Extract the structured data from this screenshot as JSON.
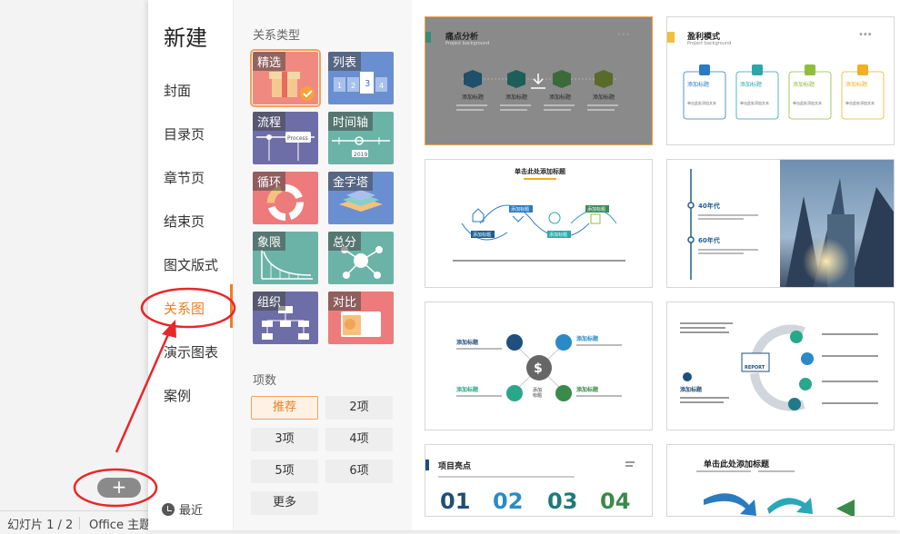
{
  "nav": {
    "title": "新建",
    "items": [
      "封面",
      "目录页",
      "章节页",
      "结束页",
      "图文版式",
      "关系图",
      "演示图表",
      "案例"
    ],
    "active": "关系图",
    "recent": "最近"
  },
  "categories": {
    "heading": "关系类型",
    "items": [
      "精选",
      "列表",
      "流程",
      "时间轴",
      "循环",
      "金字塔",
      "象限",
      "总分",
      "组织",
      "对比"
    ],
    "process_word": "Process",
    "year": "2019"
  },
  "counts": {
    "heading": "项数",
    "items": [
      "推荐",
      "2项",
      "3项",
      "4项",
      "5项",
      "6项",
      "更多"
    ]
  },
  "templates": {
    "t1": {
      "title": "痛点分析",
      "sub": "Project background",
      "label": "添加标题"
    },
    "t2": {
      "title": "盈利模式",
      "sub": "Project background",
      "label": "添加标题",
      "desc": "单击此处添加文本"
    },
    "t3": {
      "title": "单击此处添加标题",
      "label": "添加标题"
    },
    "t4": {
      "a": "40年代",
      "b": "60年代"
    },
    "t5": {
      "label": "添加标题",
      "center": "添加\n标题"
    },
    "t6": {
      "label": "添加标题",
      "report": "REPORT"
    },
    "t7": {
      "title": "项目亮点",
      "nums": [
        "01",
        "02",
        "03",
        "04"
      ]
    },
    "t8": {
      "title": "单击此处添加标题"
    }
  },
  "statusbar": {
    "slide": "幻灯片 1 / 2",
    "theme": "Office 主题"
  },
  "add_button": "+",
  "colors": {
    "accent": "#f27d21",
    "annotation": "#e8272a"
  }
}
